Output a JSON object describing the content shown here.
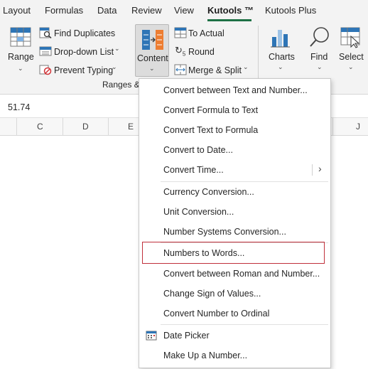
{
  "tabs": [
    {
      "label": "Layout",
      "active": false
    },
    {
      "label": "Formulas",
      "active": false
    },
    {
      "label": "Data",
      "active": false
    },
    {
      "label": "Review",
      "active": false
    },
    {
      "label": "View",
      "active": false
    },
    {
      "label": "Kutools ™",
      "active": true
    },
    {
      "label": "Kutools Plus",
      "active": false
    }
  ],
  "ribbon": {
    "range_label": "Range",
    "find_duplicates_label": "Find Duplicates",
    "dropdown_list_label": "Drop-down List",
    "prevent_typing_label": "Prevent Typing",
    "content_label": "Content",
    "to_actual_label": "To Actual",
    "round_label": "Round",
    "merge_split_label": "Merge & Split",
    "charts_label": "Charts",
    "find_label": "Find",
    "select_label": "Select",
    "group_label": "Ranges &"
  },
  "formula_bar": {
    "value": "51.74"
  },
  "columns": [
    "C",
    "D",
    "E",
    "J"
  ],
  "menu": {
    "items": [
      {
        "label": "Convert between Text and Number..."
      },
      {
        "label": "Convert Formula to Text"
      },
      {
        "label": "Convert Text to Formula"
      },
      {
        "label": "Convert to Date..."
      },
      {
        "label": "Convert Time...",
        "submenu": true
      },
      {
        "label": "Currency Conversion..."
      },
      {
        "label": "Unit Conversion..."
      },
      {
        "label": "Number Systems Conversion..."
      },
      {
        "label": "Numbers to Words...",
        "highlighted": true
      },
      {
        "label": "Convert between Roman and Number..."
      },
      {
        "label": "Change Sign of Values..."
      },
      {
        "label": "Convert Number to Ordinal"
      },
      {
        "label": "Date Picker",
        "icon": "calendar-icon"
      },
      {
        "label": "Make Up a Number..."
      }
    ]
  },
  "colors": {
    "accent": "#1e7145",
    "highlight_border": "#c0303b",
    "icon_blue": "#2e75b6",
    "icon_orange": "#ed7d31"
  }
}
